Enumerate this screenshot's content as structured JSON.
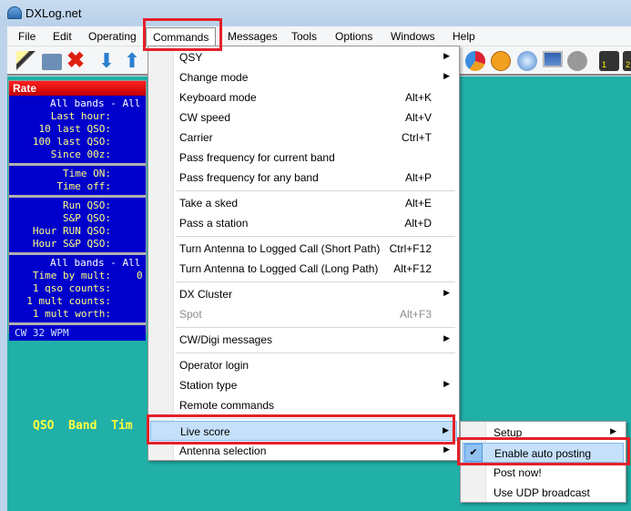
{
  "window": {
    "title": "DXLog.net"
  },
  "menubar": [
    "File",
    "Edit",
    "Operating",
    "Commands",
    "Messages",
    "Tools",
    "Options",
    "Windows",
    "Help"
  ],
  "toolbar_icons": [
    "new-log-wand-icon",
    "open-folder-icon",
    "delete-x-icon",
    "arrow-down-icon",
    "arrow-up-icon",
    "pie-chart-icon",
    "smiley-icon",
    "globe-icon",
    "monitor-icon",
    "speaker-icon",
    "radio-1-icon",
    "radio-2-icon"
  ],
  "rate": {
    "title": "Rate",
    "s1": [
      {
        "l": "All bands - All",
        "v": ""
      },
      {
        "l": "Last hour:",
        "v": ""
      },
      {
        "l": "10 last QSO:",
        "v": ""
      },
      {
        "l": "100 last QSO:",
        "v": ""
      },
      {
        "l": "Since 00z:",
        "v": ""
      }
    ],
    "s2": [
      {
        "l": "Time ON:",
        "v": ""
      },
      {
        "l": "Time off:",
        "v": ""
      }
    ],
    "s3": [
      {
        "l": "Run QSO:",
        "v": ""
      },
      {
        "l": "S&P QSO:",
        "v": ""
      },
      {
        "l": "Hour RUN QSO:",
        "v": ""
      },
      {
        "l": "Hour S&P QSO:",
        "v": ""
      }
    ],
    "s4": [
      {
        "l": "All bands - All",
        "v": ""
      },
      {
        "l": "Time by mult:",
        "v": "0"
      },
      {
        "l": "1 qso counts:",
        "v": ""
      },
      {
        "l": "1 mult counts:",
        "v": ""
      },
      {
        "l": "1 mult worth:",
        "v": ""
      }
    ],
    "footer": "CW 32 WPM"
  },
  "log_header": "QSO  Band  Tim",
  "commands_menu": [
    {
      "label": "QSY",
      "shortcut": "",
      "arrow": "▶"
    },
    {
      "label": "Change mode",
      "shortcut": "",
      "arrow": "▶"
    },
    {
      "label": "Keyboard mode",
      "shortcut": "Alt+K"
    },
    {
      "label": "CW speed",
      "shortcut": "Alt+V"
    },
    {
      "label": "Carrier",
      "shortcut": "Ctrl+T"
    },
    {
      "label": "Pass frequency for current band",
      "shortcut": ""
    },
    {
      "label": "Pass frequency for any band",
      "shortcut": "Alt+P"
    },
    {
      "label": "Take a sked",
      "shortcut": "Alt+E"
    },
    {
      "label": "Pass a station",
      "shortcut": "Alt+D"
    },
    {
      "label": "Turn Antenna to Logged Call (Short Path)",
      "shortcut": "Ctrl+F12"
    },
    {
      "label": "Turn Antenna to Logged Call (Long Path)",
      "shortcut": "Alt+F12"
    },
    {
      "label": "DX Cluster",
      "shortcut": "",
      "arrow": "▶"
    },
    {
      "label": "Spot",
      "shortcut": "Alt+F3"
    },
    {
      "label": "CW/Digi messages",
      "shortcut": "",
      "arrow": "▶"
    },
    {
      "label": "Operator login",
      "shortcut": ""
    },
    {
      "label": "Station type",
      "shortcut": "",
      "arrow": "▶"
    },
    {
      "label": "Remote commands",
      "shortcut": ""
    },
    {
      "label": "Live score",
      "shortcut": "",
      "arrow": "▶"
    },
    {
      "label": "Antenna selection",
      "shortcut": "",
      "arrow": "▶"
    }
  ],
  "live_score_submenu": [
    {
      "label": "Setup",
      "arrow": "▶"
    },
    {
      "label": "Enable auto posting",
      "check": "✔"
    },
    {
      "label": "Post now!"
    },
    {
      "label": "Use UDP broadcast"
    }
  ]
}
